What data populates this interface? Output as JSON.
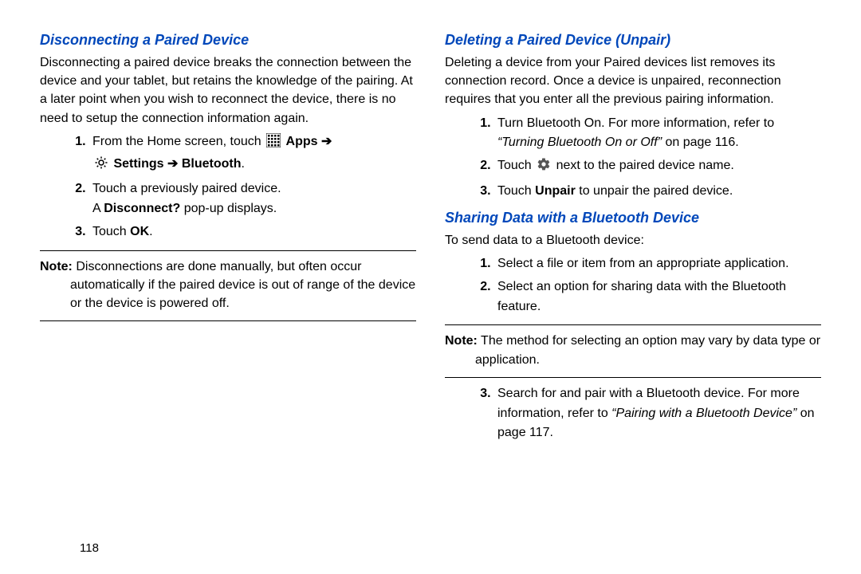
{
  "left": {
    "heading": "Disconnecting a Paired Device",
    "intro": "Disconnecting a paired device breaks the connection between the device and your tablet, but retains the knowledge of the pairing. At a later point when you wish to reconnect the device, there is no need to setup the connection information again.",
    "step1_prefix": "From the Home screen, touch ",
    "step1_apps": "Apps",
    "step1_arrow1": " ➔",
    "step1_settings": "Settings",
    "step1_arrow2": " ➔ ",
    "step1_bluetooth": "Bluetooth",
    "step1_period": ".",
    "step2_line1": "Touch a previously paired device.",
    "step2_line2a": "A ",
    "step2_line2b": "Disconnect?",
    "step2_line2c": " pop-up displays.",
    "step3_a": "Touch ",
    "step3_b": "OK",
    "step3_c": ".",
    "note_label": "Note:",
    "note_body": " Disconnections are done manually, but often occur automatically if the paired device is out of range of the device or the device is powered off."
  },
  "right": {
    "heading1": "Deleting a Paired Device (Unpair)",
    "intro1": "Deleting a device from your Paired devices list removes its connection record. Once a device is unpaired, reconnection requires that you enter all the previous pairing information.",
    "d1_a": "Turn Bluetooth On. For more information, refer to ",
    "d1_b": "“Turning Bluetooth On or Off” ",
    "d1_c": " on page 116.",
    "d2_a": "Touch ",
    "d2_b": " next to the paired device name.",
    "d3_a": "Touch ",
    "d3_b": "Unpair",
    "d3_c": " to unpair the paired device.",
    "heading2": "Sharing Data with a Bluetooth Device",
    "intro2": "To send data to a Bluetooth device:",
    "s1": "Select a file or item from an appropriate application.",
    "s2": "Select an option for sharing data with the Bluetooth feature.",
    "note_label": "Note:",
    "note_body": " The method for selecting an option may vary by data type or application.",
    "s3_a": "Search for and pair with a Bluetooth device. For more information, refer to ",
    "s3_b": "“Pairing with a Bluetooth Device”",
    "s3_c": " on page 117."
  },
  "page_number": "118"
}
